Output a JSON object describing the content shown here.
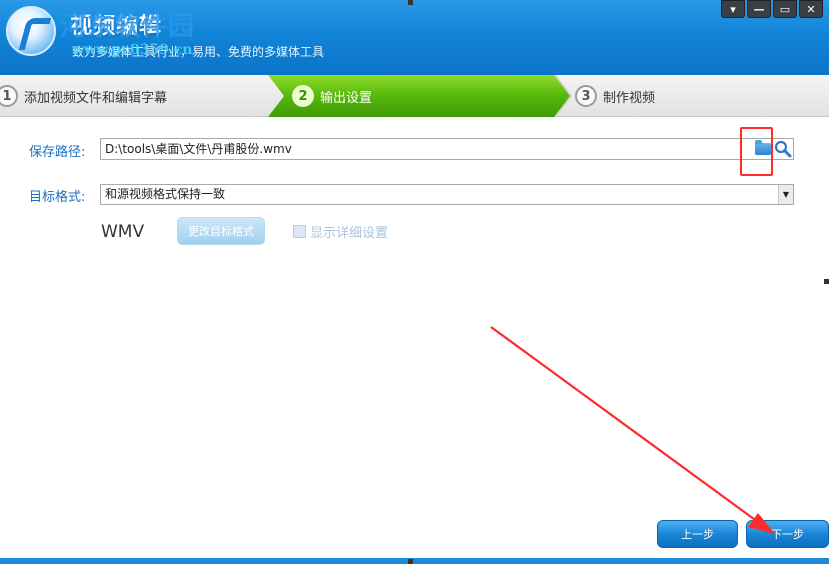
{
  "header": {
    "title": "视频编辑",
    "watermark_name": "河东软件园",
    "watermark_url": "www.pc0359.cn",
    "tagline": "致力多媒体工具行业，易用、免费的多媒体工具",
    "controls": [
      "▾",
      "—",
      "▭",
      "✕"
    ]
  },
  "steps": [
    {
      "num": "1",
      "label": "添加视频文件和编辑字幕"
    },
    {
      "num": "2",
      "label": "输出设置"
    },
    {
      "num": "3",
      "label": "制作视频"
    }
  ],
  "form": {
    "save_path_label": "保存路径:",
    "save_path_value": "D:\\tools\\桌面\\文件\\丹甫股份.wmv",
    "target_format_label": "目标格式:",
    "target_format_value": "和源视频格式保持一致",
    "format_name": "WMV",
    "change_format_label": "更改目标格式",
    "show_details_label": "显示详细设置"
  },
  "nav": {
    "prev_label": "上一步",
    "next_label": "下一步"
  },
  "colors": {
    "header_blue": "#1284d8",
    "active_step_green": "#56b80c",
    "label_blue": "#1a6fc4",
    "annotation_red": "#ff2a2a"
  }
}
